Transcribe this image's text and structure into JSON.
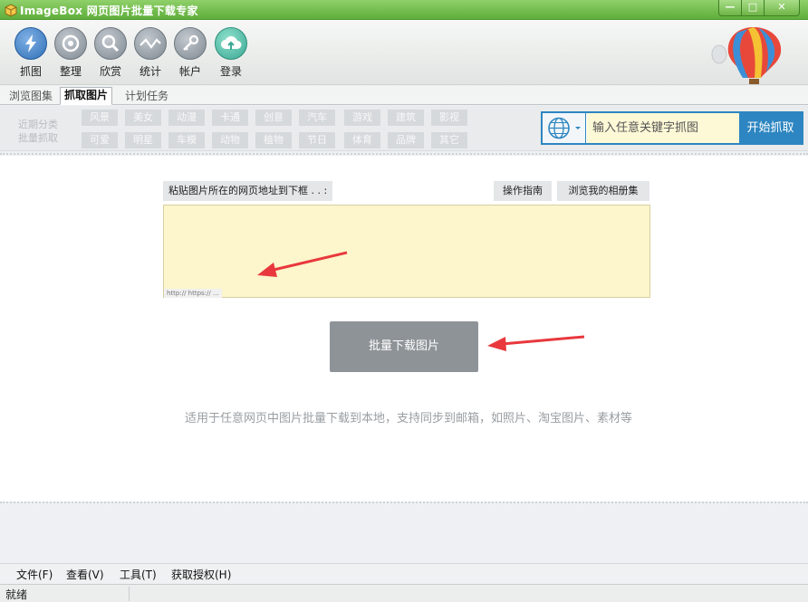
{
  "window": {
    "title": "ImageBox 网页图片批量下载专家"
  },
  "toolbar": {
    "items": [
      {
        "label": "抓图",
        "icon": "lightning-icon"
      },
      {
        "label": "整理",
        "icon": "eye-icon"
      },
      {
        "label": "欣赏",
        "icon": "magnifier-icon"
      },
      {
        "label": "统计",
        "icon": "chart-line-icon"
      },
      {
        "label": "帐户",
        "icon": "key-icon"
      },
      {
        "label": "登录",
        "icon": "cloud-upload-icon"
      }
    ]
  },
  "tabs": [
    "浏览图集",
    "抓取图片",
    "计划任务"
  ],
  "categories": {
    "recent_label": "近期分类",
    "batch_label": "批量抓取",
    "row1": [
      "风景",
      "美女",
      "动漫",
      "卡通",
      "创意",
      "汽车",
      "游戏",
      "建筑",
      "影视"
    ],
    "row2": [
      "可爱",
      "明星",
      "车模",
      "动物",
      "植物",
      "节日",
      "体育",
      "品牌",
      "其它"
    ]
  },
  "search": {
    "placeholder": "输入任意关键字抓图",
    "button": "开始抓取"
  },
  "main": {
    "url_header": "粘贴图片所在的网页地址到下框 . . :",
    "guide_button": "操作指南",
    "album_button": "浏览我的相册集",
    "url_hint": "http:// https:// ...",
    "download_button": "批量下载图片",
    "description": "适用于任意网页中图片批量下载到本地，支持同步到邮箱，如照片、淘宝图片、素材等"
  },
  "menu": [
    "文件(F)",
    "查看(V)",
    "工具(T)",
    "获取授权(H)"
  ],
  "status": {
    "text": "就绪"
  },
  "colors": {
    "title_green": "#5fae3a",
    "accent_blue": "#2d86c1",
    "input_yellow": "#fdf5cb",
    "arrow_red": "#e8383d"
  }
}
